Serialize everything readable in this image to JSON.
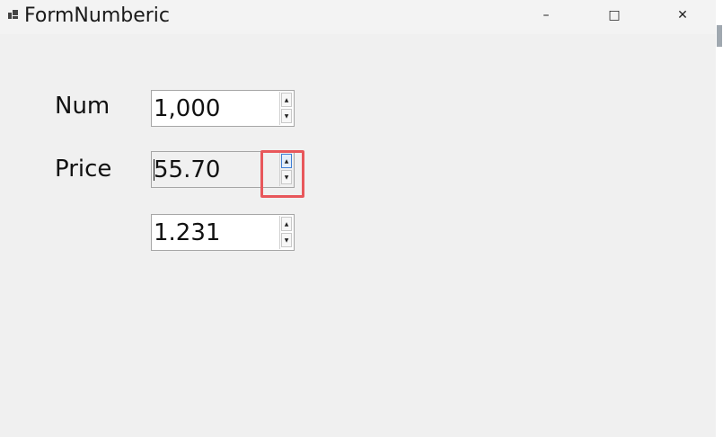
{
  "window": {
    "title": "FormNumberic",
    "app_icon": "app-icon",
    "controls": {
      "minimize": "–",
      "maximize": "□",
      "close": "✕"
    }
  },
  "form": {
    "num": {
      "label": "Num",
      "value": "1,000"
    },
    "price": {
      "label": "Price",
      "value": "55.70"
    },
    "third": {
      "value": "1.231"
    }
  },
  "spinner": {
    "up_glyph": "▲",
    "down_glyph": "▼"
  },
  "highlight_color": "#e8575b"
}
